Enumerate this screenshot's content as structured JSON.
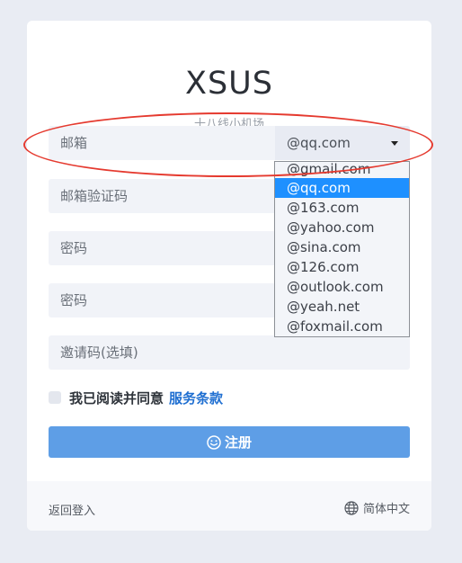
{
  "brand": {
    "title": "XSUS",
    "subtitle": "十八线小机场"
  },
  "form": {
    "email_placeholder": "邮箱",
    "email_domain": "@qq.com",
    "email_code_placeholder": "邮箱验证码",
    "password_placeholder": "密码",
    "password_confirm_placeholder": "密码",
    "invite_placeholder": "邀请码(选填)"
  },
  "domain_options": [
    "@gmail.com",
    "@qq.com",
    "@163.com",
    "@yahoo.com",
    "@sina.com",
    "@126.com",
    "@outlook.com",
    "@yeah.net",
    "@foxmail.com"
  ],
  "agreement": {
    "text": "我已阅读并同意",
    "link": "服务条款"
  },
  "register_button": "注册",
  "footer": {
    "back_login": "返回登入",
    "language": "简体中文"
  },
  "colors": {
    "primary_button": "#5e9ee6",
    "link": "#1f6fd1",
    "selected_option": "#1e90ff",
    "annotation_oval": "#e53a2f"
  },
  "icons": {
    "register": "smile-icon",
    "language": "globe-icon",
    "select": "caret-down-icon"
  }
}
